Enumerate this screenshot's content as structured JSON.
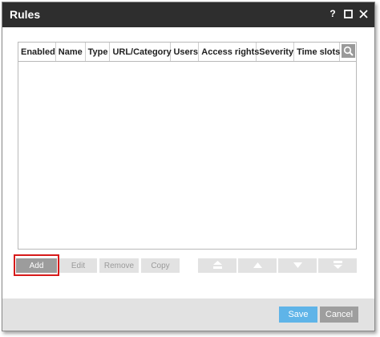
{
  "window": {
    "title": "Rules",
    "help_glyph": "?"
  },
  "grid": {
    "columns": [
      "Enabled",
      "Name",
      "Type",
      "URL/Category",
      "Users",
      "Access rights",
      "Severity",
      "Time slots"
    ],
    "rows": []
  },
  "toolbar": {
    "add_label": "Add",
    "edit_label": "Edit",
    "remove_label": "Remove",
    "copy_label": "Copy"
  },
  "footer": {
    "save_label": "Save",
    "cancel_label": "Cancel"
  },
  "colors": {
    "titlebar": "#2e2e2e",
    "save_accent": "#5fb4e8",
    "highlight": "#d71a1a"
  },
  "icons": [
    "help-icon",
    "maximize-icon",
    "close-icon",
    "search-icon",
    "move-top-icon",
    "move-up-icon",
    "move-down-icon",
    "move-bottom-icon"
  ]
}
